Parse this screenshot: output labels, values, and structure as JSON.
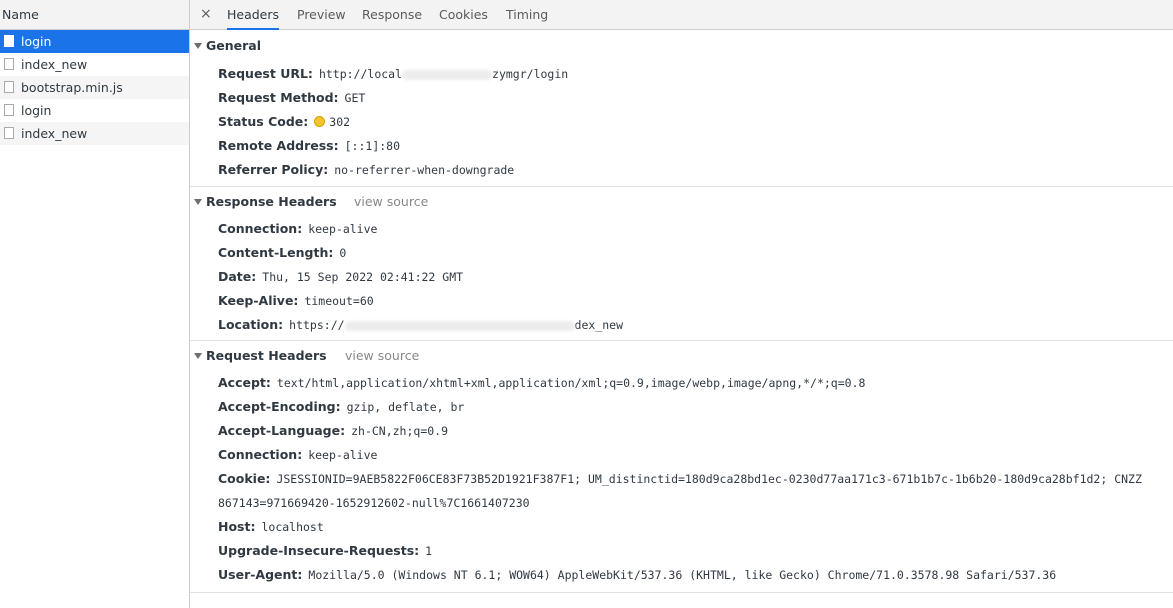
{
  "left_panel": {
    "header": "Name",
    "requests": [
      {
        "name": "login",
        "selected": true
      },
      {
        "name": "index_new",
        "selected": false
      },
      {
        "name": "bootstrap.min.js",
        "selected": false
      },
      {
        "name": "login",
        "selected": false
      },
      {
        "name": "index_new",
        "selected": false
      }
    ]
  },
  "tabs": {
    "close": "×",
    "items": [
      "Headers",
      "Preview",
      "Response",
      "Cookies",
      "Timing"
    ],
    "active": "Headers"
  },
  "general": {
    "title": "General",
    "rows": [
      {
        "name": "Request URL:",
        "value": "http://local",
        "value_tail": "zymgr/login"
      },
      {
        "name": "Request Method:",
        "value": "GET"
      },
      {
        "name": "Status Code:",
        "value": "302"
      },
      {
        "name": "Remote Address:",
        "value": "[::1]:80"
      },
      {
        "name": "Referrer Policy:",
        "value": "no-referrer-when-downgrade"
      }
    ]
  },
  "response_headers": {
    "title": "Response Headers",
    "view_source": "view source",
    "rows": [
      {
        "name": "Connection:",
        "value": "keep-alive"
      },
      {
        "name": "Content-Length:",
        "value": "0"
      },
      {
        "name": "Date:",
        "value": "Thu, 15 Sep 2022 02:41:22 GMT"
      },
      {
        "name": "Keep-Alive:",
        "value": "timeout=60"
      },
      {
        "name": "Location:",
        "value": "https://",
        "value_tail": "dex_new"
      }
    ]
  },
  "request_headers": {
    "title": "Request Headers",
    "view_source": "view source",
    "rows": [
      {
        "name": "Accept:",
        "value": "text/html,application/xhtml+xml,application/xml;q=0.9,image/webp,image/apng,*/*;q=0.8"
      },
      {
        "name": "Accept-Encoding:",
        "value": "gzip, deflate, br"
      },
      {
        "name": "Accept-Language:",
        "value": "zh-CN,zh;q=0.9"
      },
      {
        "name": "Connection:",
        "value": "keep-alive"
      },
      {
        "name": "Cookie:",
        "value": "JSESSIONID=9AEB5822F06CE83F73B52D1921F387F1; UM_distinctid=180d9ca28bd1ec-0230d77aa171c3-671b1b7c-1b6b20-180d9ca28bf1d2; CNZZ",
        "continuation": "867143=971669420-1652912602-null%7C1661407230"
      },
      {
        "name": "Host:",
        "value": "localhost"
      },
      {
        "name": "Upgrade-Insecure-Requests:",
        "value": "1"
      },
      {
        "name": "User-Agent:",
        "value": "Mozilla/5.0 (Windows NT 6.1; WOW64) AppleWebKit/537.36 (KHTML, like Gecko) Chrome/71.0.3578.98 Safari/537.36"
      }
    ]
  },
  "colors": {
    "selected_row": "#1a73e8",
    "active_tab_underline": "#1a73e8",
    "status_dot": "#f4c430"
  }
}
